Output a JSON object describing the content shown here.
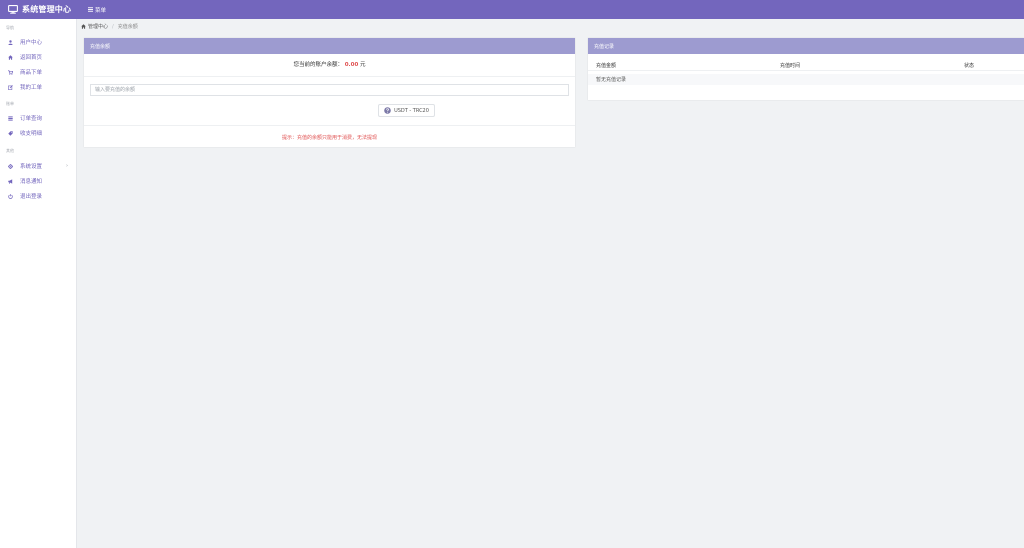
{
  "topbar": {
    "brand_title": "系统管理中心",
    "menu_label": "菜单"
  },
  "sidebar": {
    "sections": [
      {
        "title": "导航"
      },
      {
        "title": "账单"
      },
      {
        "title": "其他"
      }
    ],
    "items": [
      {
        "label": "用户中心",
        "icon": "user-icon"
      },
      {
        "label": "返回首页",
        "icon": "home-icon"
      },
      {
        "label": "商品下单",
        "icon": "cart-icon"
      },
      {
        "label": "我的工单",
        "icon": "edit-icon"
      },
      {
        "label": "订单查询",
        "icon": "list-icon"
      },
      {
        "label": "收支明细",
        "icon": "tag-icon"
      },
      {
        "label": "系统设置",
        "icon": "settings-icon",
        "chevron": "›"
      },
      {
        "label": "消息通知",
        "icon": "megaphone-icon"
      },
      {
        "label": "退出登录",
        "icon": "power-icon"
      }
    ]
  },
  "breadcrumb": {
    "home": "管理中心",
    "separator": "/",
    "current": "充值余额"
  },
  "recharge_panel": {
    "title": "充值余额",
    "balance_label": "您当前的账户余额：",
    "balance_amount": "0.00",
    "balance_unit": "元",
    "amount_placeholder": "输入要充值的余额",
    "pay_button_label": "USDT - TRC20",
    "tip": "提示：充值的余额只能用于消费，无法提现"
  },
  "records_panel": {
    "title": "充值记录",
    "columns": [
      "充值金额",
      "充值时间",
      "状态"
    ],
    "empty_text": "暂无充值记录"
  },
  "colors": {
    "topbar": "#7366bd",
    "panel_header": "#9d9bd0",
    "accent": "#7366bd",
    "highlight": "#e05252",
    "page_bg": "#f0f2f4"
  }
}
